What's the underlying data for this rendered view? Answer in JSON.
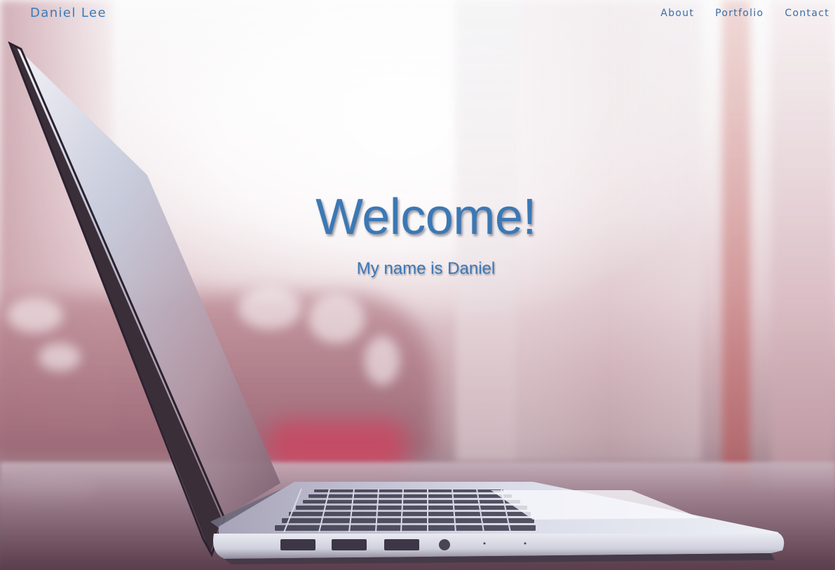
{
  "nav": {
    "brand": "Daniel Lee",
    "links": [
      "About",
      "Portfolio",
      "Contact"
    ]
  },
  "hero": {
    "title": "Welcome!",
    "subtitle": "My name is Daniel"
  },
  "colors": {
    "accent": "#3b78b5",
    "nav_text": "#3a6ea8"
  },
  "background": {
    "image_icon": "laptop-on-desk-photo-icon"
  }
}
